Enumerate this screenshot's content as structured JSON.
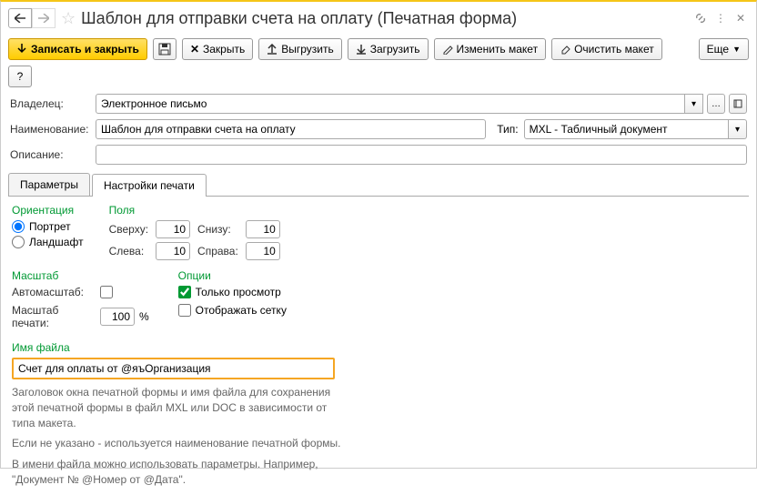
{
  "title": "Шаблон для отправки счета на оплату (Печатная форма)",
  "toolbar": {
    "saveClose": "Записать и закрыть",
    "close": "Закрыть",
    "upload": "Выгрузить",
    "download": "Загрузить",
    "editLayout": "Изменить макет",
    "clearLayout": "Очистить макет",
    "more": "Еще"
  },
  "labels": {
    "owner": "Владелец:",
    "name": "Наименование:",
    "type": "Тип:",
    "desc": "Описание:"
  },
  "values": {
    "owner": "Электронное письмо",
    "name": "Шаблон для отправки счета на оплату",
    "type": "MXL - Табличный документ",
    "desc": ""
  },
  "tabs": {
    "params": "Параметры",
    "print": "Настройки печати"
  },
  "print": {
    "orientation": {
      "title": "Ориентация",
      "portrait": "Портрет",
      "landscape": "Ландшафт"
    },
    "fields": {
      "title": "Поля",
      "top": "Сверху:",
      "bottom": "Снизу:",
      "left": "Слева:",
      "right": "Справа:",
      "topV": "10",
      "bottomV": "10",
      "leftV": "10",
      "rightV": "10"
    },
    "scale": {
      "title": "Масштаб",
      "auto": "Автомасштаб:",
      "print": "Масштаб печати:",
      "printV": "100",
      "pct": "%"
    },
    "options": {
      "title": "Опции",
      "readonly": "Только просмотр",
      "grid": "Отображать сетку"
    },
    "filename": {
      "title": "Имя файла",
      "value": "Счет для оплаты от @яъОрганизация"
    },
    "help1": "Заголовок окна печатной формы и имя файла для сохранения этой печатной формы в файл MXL или DOC в зависимости от типа макета.",
    "help2": "Если не указано - используется наименование печатной формы.",
    "help3": "В имени файла можно использовать параметры. Например, \"Документ № @Номер от @Дата\"."
  }
}
